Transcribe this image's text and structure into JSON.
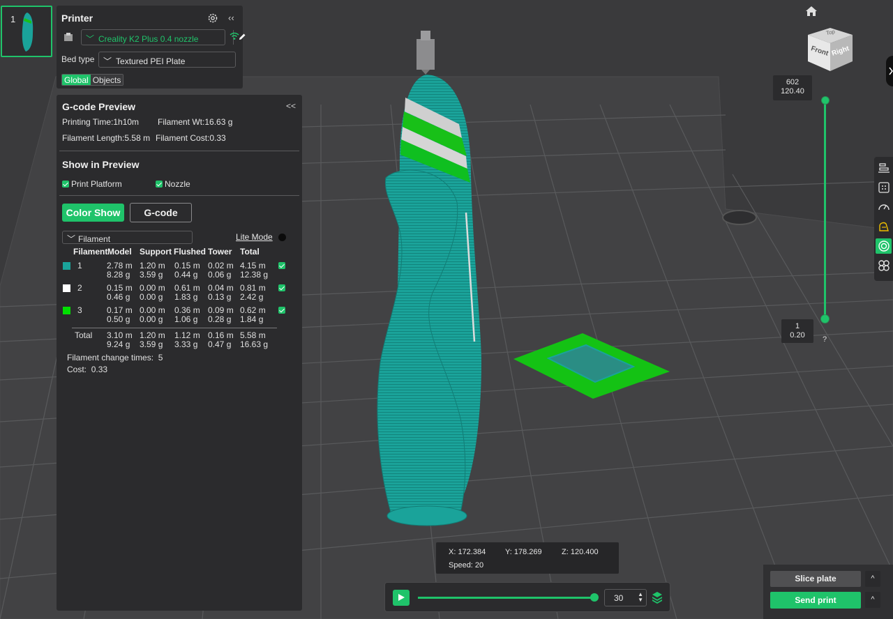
{
  "plate": {
    "number": "1"
  },
  "printer": {
    "title": "Printer",
    "selected": "Creality K2 Plus 0.4 nozzle",
    "bed_type_label": "Bed type",
    "bed_type": "Textured PEI Plate",
    "tabs": [
      "Global",
      "Objects"
    ],
    "collapse_glyph": "‹‹"
  },
  "gcode_preview": {
    "title": "G-code Preview",
    "collapse_glyph": "<<",
    "printing_time": "Printing Time:1h10m",
    "filament_wt": "Filament Wt:16.63 g",
    "filament_length": "Filament Length:5.58 m",
    "filament_cost": "Filament Cost:0.33"
  },
  "show_in_preview": {
    "title": "Show in Preview",
    "print_platform": "Print Platform",
    "nozzle": "Nozzle"
  },
  "view_buttons": {
    "color_show": "Color Show",
    "gcode": "G-code"
  },
  "filament_table": {
    "select_label": "Filament",
    "lite_mode": "Lite Mode",
    "headers": [
      "Filament",
      "Model",
      "Support",
      "Flushed",
      "Tower",
      "Total"
    ],
    "rows": [
      {
        "id": "1",
        "color": "#1aa39a",
        "model": [
          "2.78 m",
          "8.28 g"
        ],
        "support": [
          "1.20 m",
          "3.59 g"
        ],
        "flushed": [
          "0.15 m",
          "0.44 g"
        ],
        "tower": [
          "0.02 m",
          "0.06 g"
        ],
        "total": [
          "4.15 m",
          "12.38 g"
        ]
      },
      {
        "id": "2",
        "color": "#ffffff",
        "model": [
          "0.15 m",
          "0.46 g"
        ],
        "support": [
          "0.00 m",
          "0.00 g"
        ],
        "flushed": [
          "0.61 m",
          "1.83 g"
        ],
        "tower": [
          "0.04 m",
          "0.13 g"
        ],
        "total": [
          "0.81 m",
          "2.42 g"
        ]
      },
      {
        "id": "3",
        "color": "#00e000",
        "model": [
          "0.17 m",
          "0.50 g"
        ],
        "support": [
          "0.00 m",
          "0.00 g"
        ],
        "flushed": [
          "0.36 m",
          "1.06 g"
        ],
        "tower": [
          "0.09 m",
          "0.28 g"
        ],
        "total": [
          "0.62 m",
          "1.84 g"
        ]
      }
    ],
    "total_row": {
      "label": "Total",
      "model": [
        "3.10 m",
        "9.24 g"
      ],
      "support": [
        "1.20 m",
        "3.59 g"
      ],
      "flushed": [
        "1.12 m",
        "3.33 g"
      ],
      "tower": [
        "0.16 m",
        "0.47 g"
      ],
      "total": [
        "5.58 m",
        "16.63 g"
      ]
    },
    "change_times_label": "Filament change times:",
    "change_times": "5",
    "cost_label": "Cost:",
    "cost": "0.33"
  },
  "cube_labels": {
    "top": "Top",
    "front": "Front",
    "right": "Right"
  },
  "layer_slider": {
    "top_layer": "602",
    "top_height": "120.40",
    "bottom_layer": "1",
    "bottom_height": "0.20",
    "help": "?"
  },
  "coords": {
    "x": "X: 172.384",
    "y": "Y: 178.269",
    "z": "Z: 120.400",
    "speed": "Speed: 20"
  },
  "playback": {
    "step": "30"
  },
  "actions": {
    "slice": "Slice plate",
    "send": "Send print",
    "more": "^"
  },
  "colors": {
    "accent": "#1fc36a",
    "model": "#1aa39a",
    "bed": "#3c3c3e",
    "panel": "#2b2b2d"
  }
}
